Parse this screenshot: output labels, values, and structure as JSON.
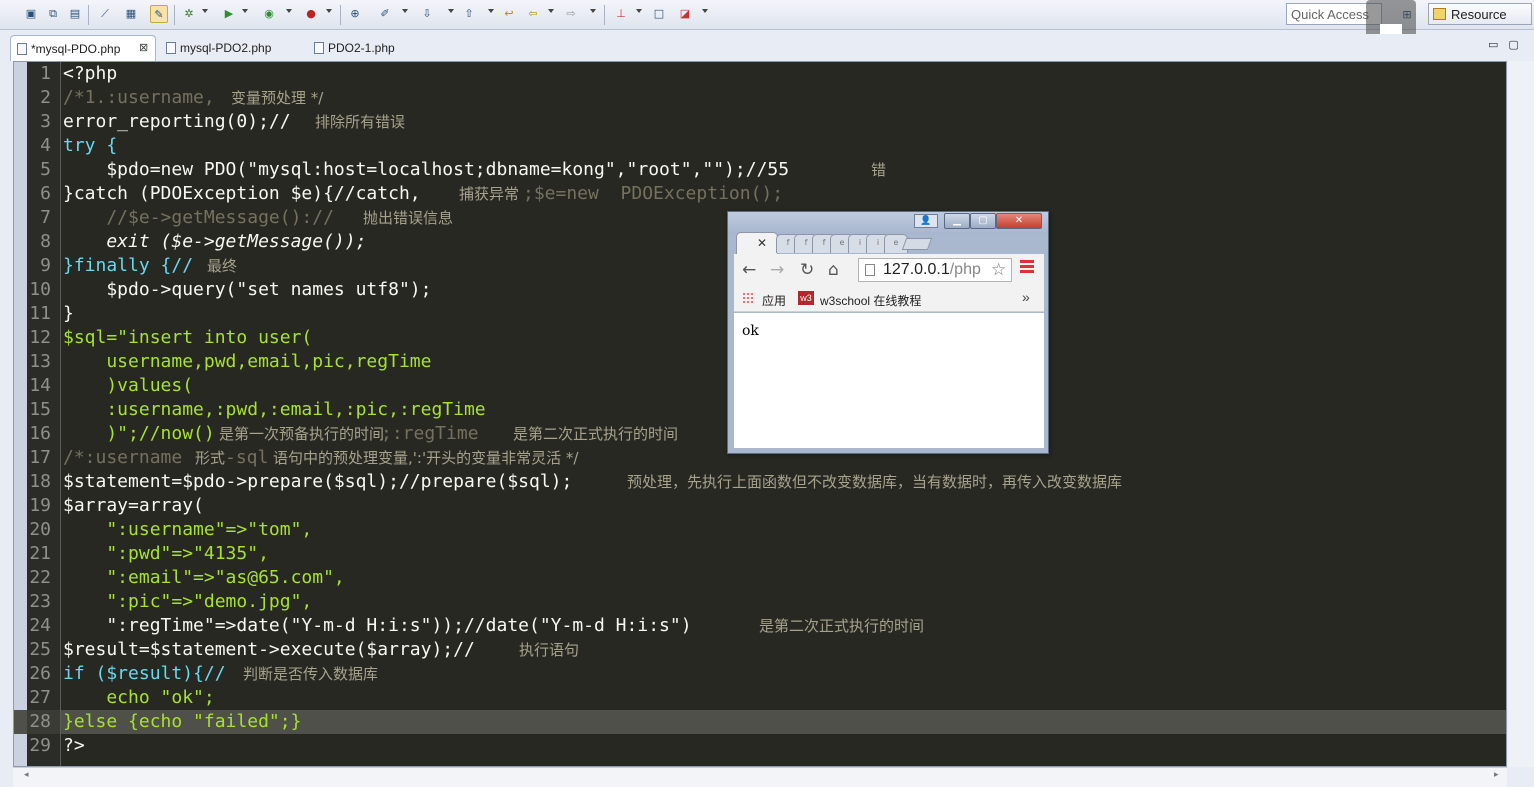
{
  "toolbar": {
    "quick_access_placeholder": "Quick Access",
    "perspective_label": "Resource"
  },
  "tabs": [
    {
      "label": "*mysql-PDO.php",
      "active": true,
      "close": "⊠"
    },
    {
      "label": "mysql-PDO2.php",
      "active": false
    },
    {
      "label": "PDO2-1.php",
      "active": false
    }
  ],
  "editor": {
    "line_numbers": [
      "1",
      "2",
      "3",
      "4",
      "5",
      "6",
      "7",
      "8",
      "9",
      "10",
      "11",
      "12",
      "13",
      "14",
      "15",
      "16",
      "17",
      "18",
      "19",
      "20",
      "21",
      "22",
      "23",
      "24",
      "25",
      "26",
      "27",
      "28",
      "29"
    ],
    "lines": [
      {
        "code": "<?php",
        "comment": ""
      },
      {
        "code": "/*1.:username,",
        "comment": "变量预处理 */"
      },
      {
        "code": "error_reporting(0);//",
        "comment": "排除所有错误"
      },
      {
        "code": "try {",
        "comment": ""
      },
      {
        "code": "    $pdo=new PDO(\"mysql:host=localhost;dbname=kong\",\"root\",\"\");//55",
        "comment": "错"
      },
      {
        "code": "}catch (PDOException $e){//catch,",
        "comment": "捕获异常",
        "code2": ";$e=new  PDOException();"
      },
      {
        "code": "    //$e->getMessage()://",
        "comment": "抛出错误信息"
      },
      {
        "code": "    exit ($e->getMessage());",
        "comment": ""
      },
      {
        "code": "}finally {//",
        "comment": "最终"
      },
      {
        "code": "    $pdo->query(\"set names utf8\");",
        "comment": ""
      },
      {
        "code": "}",
        "comment": ""
      },
      {
        "code": "$sql=\"insert into user(",
        "comment": ""
      },
      {
        "code": "    username,pwd,email,pic,regTime",
        "comment": ""
      },
      {
        "code": "    )values(",
        "comment": ""
      },
      {
        "code": "    :username,:pwd,:email,:pic,:regTime",
        "comment": ""
      },
      {
        "code": "    )\";//now()",
        "comment": "是第一次预备执行的时间",
        "code2": ";:regTime",
        "comment2": "是第二次正式执行的时间"
      },
      {
        "code": "/*:username",
        "comment": "形式",
        "code2": "-sql",
        "comment2": "语句中的预处理变量,':'开头的变量非常灵活 */"
      },
      {
        "code": "$statement=$pdo->prepare($sql);//prepare($sql);",
        "comment": "预处理，先执行上面函数但不改变数据库，当有数据时，再传入改变数据库"
      },
      {
        "code": "$array=array(",
        "comment": ""
      },
      {
        "code": "    \":username\"=>\"tom\",",
        "comment": ""
      },
      {
        "code": "    \":pwd\"=>\"4135\",",
        "comment": ""
      },
      {
        "code": "    \":email\"=>\"as@65.com\",",
        "comment": ""
      },
      {
        "code": "    \":pic\"=>\"demo.jpg\",",
        "comment": ""
      },
      {
        "code": "    \":regTime\"=>date(\"Y-m-d H:i:s\"));//date(\"Y-m-d H:i:s\")",
        "comment": "是第二次正式执行的时间"
      },
      {
        "code": "$result=$statement->execute($array);//",
        "comment": "执行语句"
      },
      {
        "code": "if ($result){//",
        "comment": "判断是否传入数据库"
      },
      {
        "code": "    echo \"ok\";",
        "comment": ""
      },
      {
        "code": "}else {echo \"failed\";}",
        "comment": ""
      },
      {
        "code": "?>",
        "comment": ""
      }
    ],
    "highlighted_line": 28
  },
  "browser": {
    "url_host": "127.0.0.1",
    "url_path": "/php",
    "bookmark_apps": "应用",
    "bookmark_w3": "w3school 在线教程",
    "bookmark_w3_icon": "w3",
    "page_text": "ok",
    "more_label": "»"
  },
  "colors": {
    "editor_bg": "#272822",
    "keyword": "#66d9ef",
    "string": "#a6e22e",
    "comment": "#75715e",
    "number": "#f92672"
  }
}
